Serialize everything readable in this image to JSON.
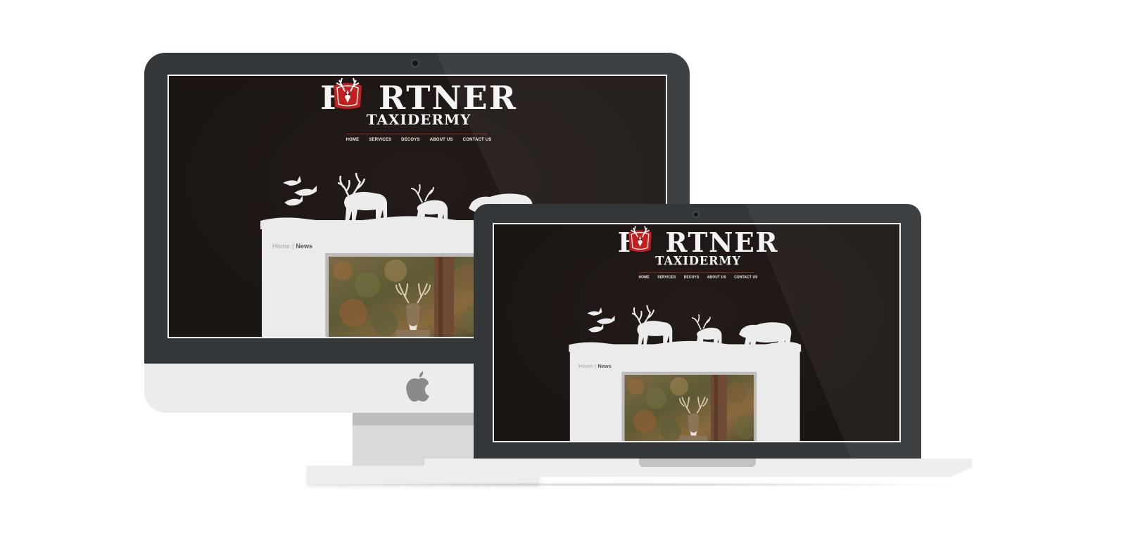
{
  "site": {
    "logo_title_left": "F",
    "logo_title_right": "RTNER",
    "logo_subtitle": "TAXIDERMY",
    "nav": [
      "HOME",
      "SERVICES",
      "DECOYS",
      "ABOUT US",
      "CONTACT US"
    ],
    "breadcrumb": {
      "home": "Home",
      "separator": "|",
      "current": "News"
    }
  },
  "icons": {
    "brand": "apple-logo-icon",
    "emblem": "deer-skull-emblem-icon"
  },
  "colors": {
    "site_background": "#1d1715",
    "accent_red": "#c21f1f",
    "text_light": "#f4f4f4",
    "panel": "#ebebeb",
    "device_bezel": "#33373a"
  }
}
